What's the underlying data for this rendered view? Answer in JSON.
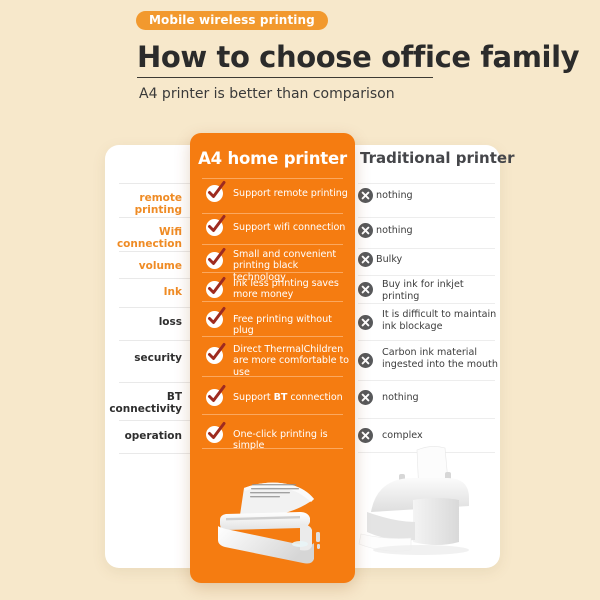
{
  "header": {
    "badge": "Mobile wireless printing",
    "title": "How to choose office family",
    "subtitle": "A4 printer is better than comparison"
  },
  "colors": {
    "background": "#f7e8cb",
    "accent_orange": "#f57c11",
    "badge_orange": "#f2992e",
    "label_orange": "#ef8b24",
    "x_icon_gray": "#58595b",
    "check_mark": "#9e2b20",
    "card_white": "#ffffff"
  },
  "columns": {
    "feature_label_header": "",
    "highlight_header": "A4 home printer",
    "traditional_header": "Traditional printer"
  },
  "rows": [
    {
      "feature": "remote printing",
      "feature_style": "orange",
      "a4": "Support remote printing",
      "a4_icon": "check-icon",
      "traditional": "nothing",
      "traditional_icon": "x-icon"
    },
    {
      "feature": "Wifi connection",
      "feature_style": "orange",
      "a4": "Support wifi connection",
      "a4_icon": "check-icon",
      "traditional": "nothing",
      "traditional_icon": "x-icon"
    },
    {
      "feature": "volume",
      "feature_style": "orange",
      "a4": "Small and convenient\nprinting black technology",
      "a4_icon": "check-icon",
      "traditional": "Bulky",
      "traditional_icon": "x-icon"
    },
    {
      "feature": "Ink",
      "feature_style": "orange",
      "a4": "Ink less printing saves\n more money",
      "a4_icon": "check-icon",
      "traditional": "Buy ink for inkjet printing",
      "traditional_icon": "x-icon"
    },
    {
      "feature": "loss",
      "feature_style": "dark",
      "a4": "Free printing without plug",
      "a4_icon": "check-icon",
      "traditional": "It is difficult to maintain\n ink blockage",
      "traditional_icon": "x-icon"
    },
    {
      "feature": "security",
      "feature_style": "dark",
      "a4": "Direct ThermalChildren\nare more comfortable to use",
      "a4_icon": "check-icon",
      "traditional": "Carbon ink material\ningested into the mouth",
      "traditional_icon": "x-icon"
    },
    {
      "feature": "BT\nconnectivity",
      "feature_style": "dark",
      "a4": "Support BT connection",
      "a4_bold_word": "BT",
      "a4_icon": "check-icon",
      "traditional": "nothing",
      "traditional_icon": "x-icon"
    },
    {
      "feature": "operation",
      "feature_style": "dark",
      "a4": "One-click printing is simple",
      "a4_icon": "check-icon",
      "traditional": "complex",
      "traditional_icon": "x-icon"
    }
  ],
  "illustrations": {
    "a4_printer": "a4-thermal-printer-illustration",
    "traditional_printer": "traditional-inkjet-printer-illustration"
  }
}
